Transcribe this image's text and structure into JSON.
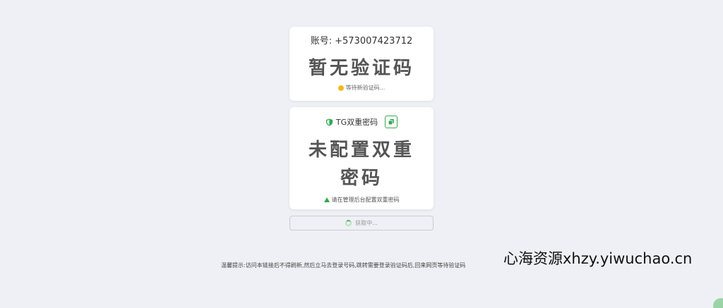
{
  "account": {
    "label": "账号:",
    "number": "+573007423712",
    "code": "暂无验证码",
    "status": "等待新验证码..."
  },
  "two_factor": {
    "title": "TG双重密码",
    "value": "未配置双重密码",
    "warning": "请在管理后台配置双重密码",
    "icon": "shield-icon",
    "copy_icon": "copy-icon"
  },
  "fetch_button": {
    "label": "获取中..."
  },
  "tip": "温馨提示:访问本链接后不得刷新,然后立马去登录号码,跳转需要登录验证码后,回来网页等待验证码",
  "watermark": "心海资源xhzy.yiwuchao.cn",
  "colors": {
    "background": "#eef0f5",
    "accent": "#2fa84f",
    "status_dot": "#f5b820"
  }
}
